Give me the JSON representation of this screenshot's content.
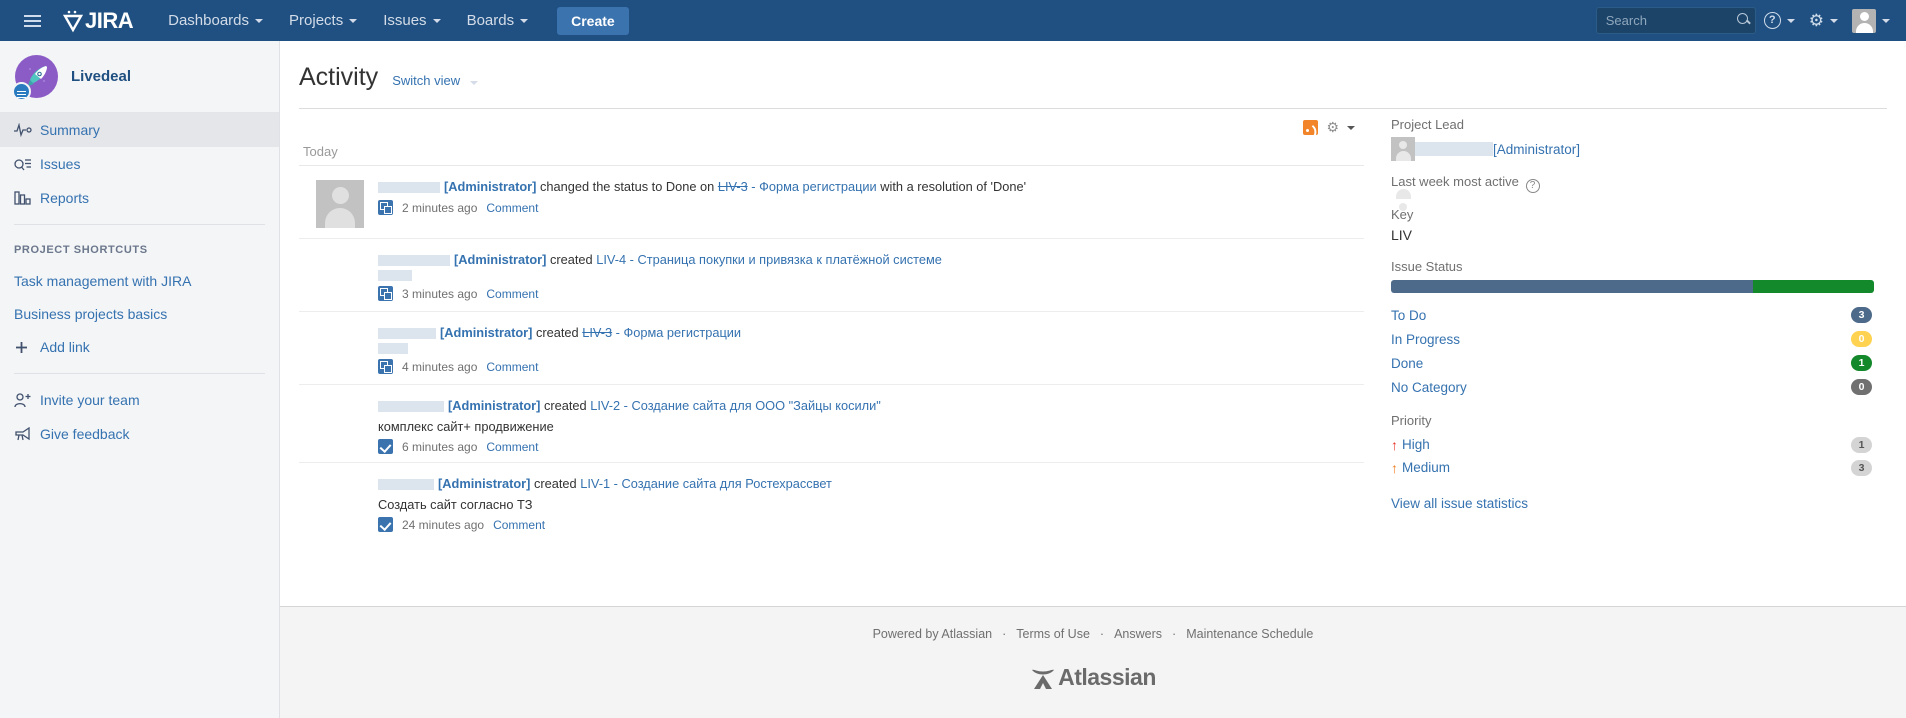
{
  "topnav": {
    "brand": "JIRA",
    "menu": [
      {
        "label": "Dashboards"
      },
      {
        "label": "Projects"
      },
      {
        "label": "Issues"
      },
      {
        "label": "Boards"
      }
    ],
    "create_label": "Create",
    "search_placeholder": "Search",
    "search_value": ""
  },
  "sidebar": {
    "project_name": "Livedeal",
    "items": [
      {
        "label": "Summary",
        "icon": "activity-icon",
        "active": true
      },
      {
        "label": "Issues",
        "icon": "issues-icon",
        "active": false
      },
      {
        "label": "Reports",
        "icon": "reports-icon",
        "active": false
      }
    ],
    "shortcuts_title": "PROJECT SHORTCUTS",
    "shortcuts": [
      {
        "label": "Task management with JIRA"
      },
      {
        "label": "Business projects basics"
      }
    ],
    "add_link_label": "Add link",
    "invite_label": "Invite your team",
    "feedback_label": "Give feedback"
  },
  "main": {
    "title": "Activity",
    "switch_view": "Switch view",
    "today_label": "Today",
    "comment_label": "Comment",
    "activities": [
      {
        "user": "[Administrator]",
        "action": "changed the status to Done on",
        "issue_key": "LIV-3",
        "issue_key_struck": true,
        "issue_sep": " - ",
        "issue_title": "Форма регистрации",
        "suffix": "with a resolution of 'Done'",
        "description": "",
        "time": "2 minutes ago",
        "type": "task",
        "has_avatar": true
      },
      {
        "user": "[Administrator]",
        "action": "created",
        "issue_key": "LIV-4",
        "issue_key_struck": false,
        "issue_sep": " - ",
        "issue_title": "Страница покупки и привязка к платёжной системе",
        "suffix": "",
        "description": "",
        "time": "3 minutes ago",
        "type": "task",
        "has_avatar": false
      },
      {
        "user": "[Administrator]",
        "action": "created",
        "issue_key": "LIV-3",
        "issue_key_struck": true,
        "issue_sep": " - ",
        "issue_title": "Форма регистрации",
        "suffix": "",
        "description": "",
        "time": "4 minutes ago",
        "type": "task",
        "has_avatar": false
      },
      {
        "user": "[Administrator]",
        "action": "created",
        "issue_key": "LIV-2",
        "issue_key_struck": false,
        "issue_sep": " - ",
        "issue_title": "Создание сайта для ООО \"Зайцы косили\"",
        "suffix": "",
        "description": "комплекс сайт+ продвижение",
        "time": "6 minutes ago",
        "type": "check",
        "has_avatar": false
      },
      {
        "user": "[Administrator]",
        "action": "created",
        "issue_key": "LIV-1",
        "issue_key_struck": false,
        "issue_sep": " - ",
        "issue_title": "Создание сайта для Ростехрассвет",
        "suffix": "",
        "description": "Создать сайт согласно ТЗ",
        "time": "24 minutes ago",
        "type": "check",
        "has_avatar": false
      }
    ]
  },
  "right_panel": {
    "project_lead_label": "Project Lead",
    "project_lead_name": "[Administrator]",
    "last_week_label": "Last week most active",
    "key_label": "Key",
    "key_value": "LIV",
    "issue_status_label": "Issue Status",
    "status_rows": [
      {
        "label": "To Do",
        "count": "3",
        "color": "#4d6a8a"
      },
      {
        "label": "In Progress",
        "count": "0",
        "color": "#ffd351"
      },
      {
        "label": "Done",
        "count": "1",
        "color": "#14892c"
      },
      {
        "label": "No Category",
        "count": "0",
        "color": "#707070"
      }
    ],
    "status_bar_segments": [
      {
        "color": "#4d6a8a",
        "percent": 75
      },
      {
        "color": "#14892c",
        "percent": 25
      }
    ],
    "priority_label": "Priority",
    "priority_rows": [
      {
        "label": "High",
        "count": "1",
        "color": "#e8352b"
      },
      {
        "label": "Medium",
        "count": "3",
        "color": "#ef7e21"
      }
    ],
    "view_all_label": "View all issue statistics"
  },
  "footer": {
    "links": [
      "Powered by Atlassian",
      "Terms of Use",
      "Answers",
      "Maintenance Schedule"
    ],
    "separator": "·",
    "logo_text": "Atlassian"
  }
}
